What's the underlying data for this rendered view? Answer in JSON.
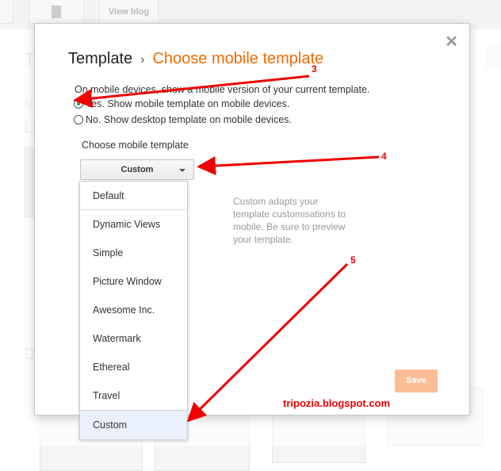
{
  "background": {
    "view_blog_label": "View blog",
    "heading_fragments": [
      "T",
      "St",
      "Li",
      "D"
    ]
  },
  "dialog": {
    "breadcrumb_root": "Template",
    "breadcrumb_separator": "›",
    "title": "Choose mobile template",
    "description": "On mobile devices, show a mobile version of your current template.",
    "radio_yes": "Yes. Show mobile template on mobile devices.",
    "radio_no": "No. Show desktop template on mobile devices.",
    "radio_selected": "yes",
    "select_label": "Choose mobile template",
    "select_value": "Custom",
    "hint": "Custom adapts your template customisations to mobile. Be sure to preview your template.",
    "save_label": "Save",
    "close_icon": "close-icon",
    "accent_color": "#f26b00"
  },
  "menu": {
    "items": [
      "Default",
      "Dynamic Views",
      "Simple",
      "Picture Window",
      "Awesome Inc.",
      "Watermark",
      "Ethereal",
      "Travel",
      "Custom"
    ],
    "highlighted": "Custom"
  },
  "annotations": {
    "step3": "3",
    "step4": "4",
    "step5": "5",
    "watermark": "tripozia.blogspot.com",
    "arrow_color": "#ee0000"
  }
}
